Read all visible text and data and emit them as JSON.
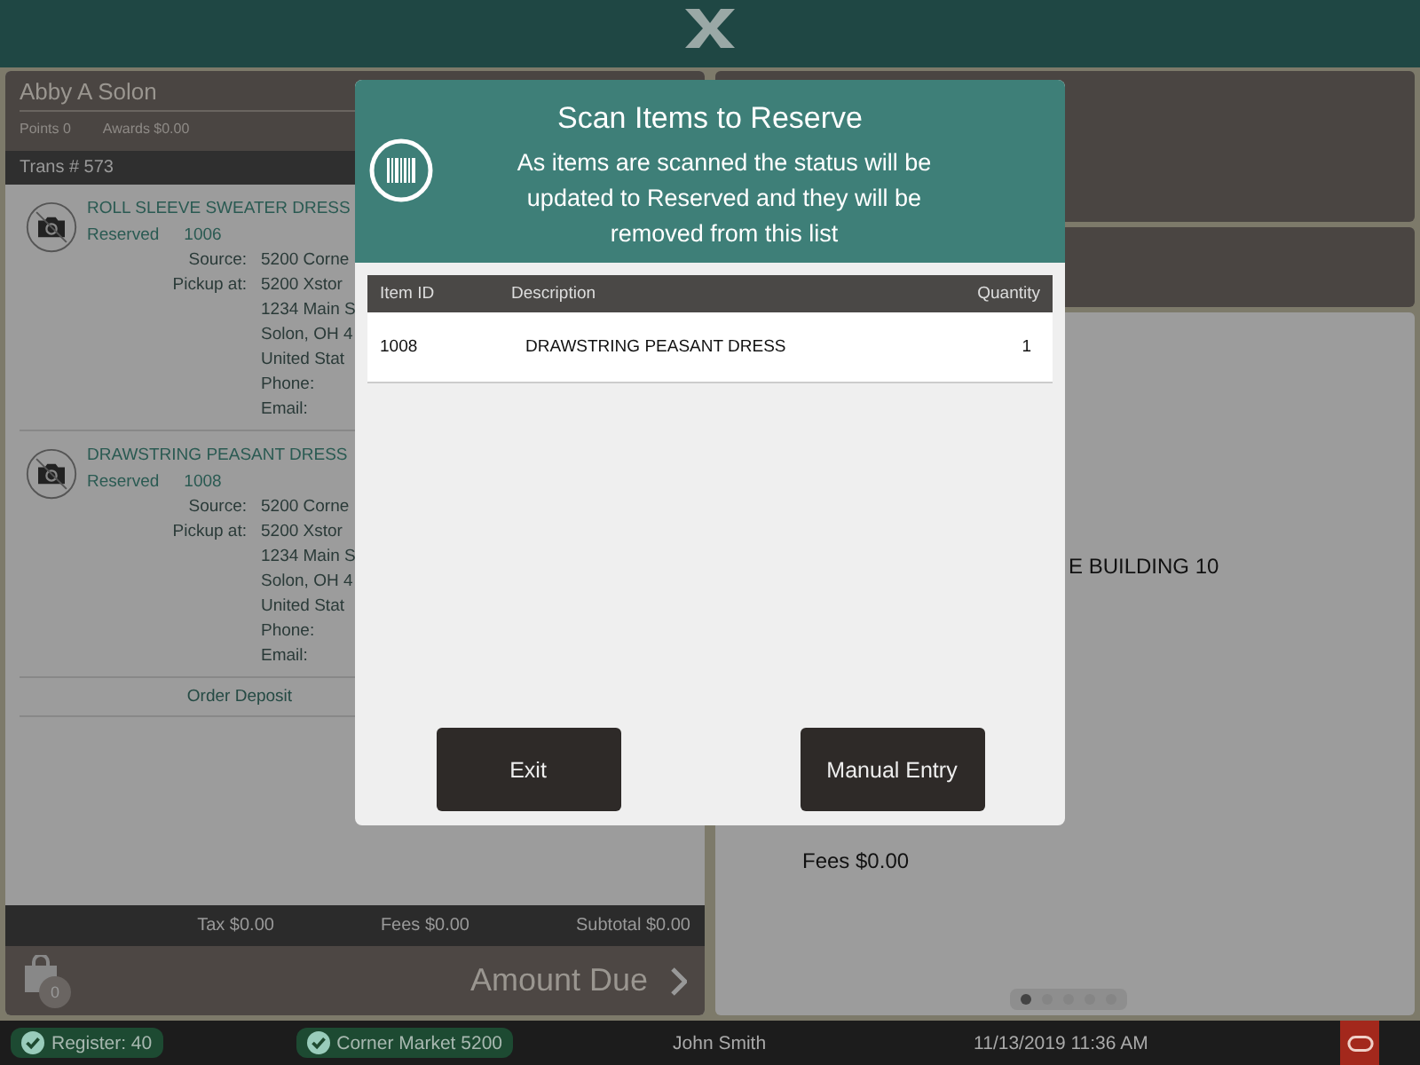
{
  "customer": {
    "name": "Abby A Solon",
    "points": "Points 0",
    "awards": "Awards $0.00"
  },
  "transaction": "Trans # 573",
  "items": [
    {
      "name": "ROLL SLEEVE SWEATER DRESS",
      "status": "Reserved",
      "id": "1006",
      "details": [
        {
          "label": "Source:",
          "lines": [
            "5200 Corne"
          ]
        },
        {
          "label": "Pickup at:",
          "lines": [
            "5200 Xstor",
            "1234 Main S",
            "Solon, OH 4",
            "United Stat",
            "Phone:",
            "Email:"
          ]
        }
      ]
    },
    {
      "name": "DRAWSTRING PEASANT DRESS",
      "status": "Reserved",
      "id": "1008",
      "details": [
        {
          "label": "Source:",
          "lines": [
            "5200 Corne"
          ]
        },
        {
          "label": "Pickup at:",
          "lines": [
            "5200 Xstor",
            "1234 Main S",
            "Solon, OH 4",
            "United Stat",
            "Phone:",
            "Email:"
          ]
        }
      ]
    }
  ],
  "order_deposit": "Order Deposit",
  "totals": {
    "tax": "Tax $0.00",
    "fees": "Fees $0.00",
    "subtotal": "Subtotal $0.00"
  },
  "amount_due": {
    "label": "Amount Due",
    "bag_count": "0"
  },
  "right_panel": {
    "address_fragment": "E BUILDING 10",
    "fees": "Fees $0.00",
    "pages": [
      {
        "selected": true
      },
      {
        "selected": false
      },
      {
        "selected": false
      },
      {
        "selected": false
      },
      {
        "selected": false
      }
    ]
  },
  "status_bar": {
    "register": "Register: 40",
    "store": "Corner Market 5200",
    "user": "John Smith",
    "datetime": "11/13/2019 11:36 AM"
  },
  "modal": {
    "title": "Scan Items to Reserve",
    "message": "As items are scanned the status will be updated to Reserved and they will be removed from this list",
    "table": {
      "columns": [
        "Item ID",
        "Description",
        "Quantity"
      ],
      "rows": [
        {
          "item_id": "1008",
          "description": "DRAWSTRING PEASANT DRESS",
          "quantity": "1"
        }
      ]
    },
    "buttons": [
      "Exit",
      "Manual Entry"
    ]
  }
}
